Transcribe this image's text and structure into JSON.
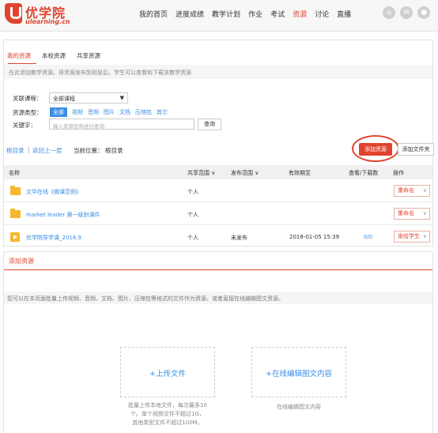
{
  "header": {
    "logo_text": "优学院",
    "logo_sub": "ulearning.cn",
    "nav": [
      "我的首页",
      "进度成绩",
      "教学计划",
      "作业",
      "考试",
      "资源",
      "讨论",
      "直播"
    ],
    "nav_active": "资源",
    "icons": [
      "home-icon",
      "mail-icon",
      "user-icon"
    ]
  },
  "resources": {
    "tabs": [
      "我的资源",
      "本校资源",
      "共享资源"
    ],
    "active_tab": "我的资源",
    "info": "在此添加教学资源。将资源发布到班级后，学生可以查看和下载该教学资源",
    "filters": {
      "course_label": "关联课程：",
      "course_value": "全部课程",
      "type_label": "资源类型：",
      "types": [
        "全部",
        "视频",
        "音频",
        "图片",
        "文档",
        "压缩包",
        "其它"
      ],
      "keyword_label": "关键字：",
      "keyword_placeholder": "输入资源名称进行查询",
      "query_button": "查询"
    },
    "breadcrumb": {
      "root": "根目录",
      "separator": "|",
      "back": "返回上一层",
      "current_label": "当前位置：",
      "current_value": "根目录"
    },
    "add_button": "添加资源",
    "add_folder_button": "添加文件夹",
    "columns": {
      "name": "名称",
      "share": "共享范围",
      "publish": "发布范围",
      "expiry": "有效期至",
      "views": "查看/下载数",
      "ops": "操作"
    },
    "rows": [
      {
        "type": "folder",
        "name": "文华在线《微课范例》",
        "share": "个人",
        "publish": "",
        "expiry": "",
        "views": "",
        "op": "重命名"
      },
      {
        "type": "folder",
        "name": "market leader 第一级别课件",
        "share": "个人",
        "publish": "",
        "expiry": "",
        "views": "",
        "op": "重命名"
      },
      {
        "type": "video",
        "name": "优学院导学课_2016.9",
        "share": "个人",
        "publish": "未发布",
        "expiry": "2018-01-05 15:39",
        "views": "0/0",
        "op": "发给学生"
      }
    ]
  },
  "add_panel": {
    "title": "添加资源",
    "info": "您可以在本页面批量上传视频、音频、文档、图片、压缩包等格式的文件作为资源，或者直接在线编辑图文资源。",
    "upload_label": "+上传文件",
    "upload_hint": [
      "批量上传本地文件，每次最多10",
      "个。单个视频文件不超过1G，",
      "其他类型文件不超过100M。"
    ],
    "edit_label": "+在线编辑图文内容",
    "edit_hint": "在线编辑图文内容"
  },
  "colors": {
    "brand": "#e0432f",
    "link": "#3a8ee6",
    "folder": "#f5b82e"
  }
}
